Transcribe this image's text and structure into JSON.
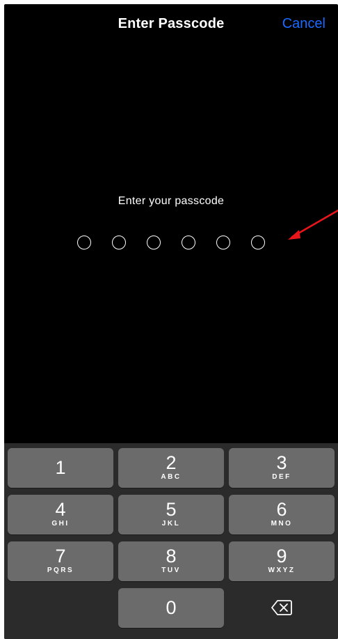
{
  "nav": {
    "title": "Enter Passcode",
    "cancel_label": "Cancel",
    "cancel_color": "#1a6aff"
  },
  "prompt": "Enter your passcode",
  "passcode": {
    "length": 6,
    "entered": 0
  },
  "annotation": {
    "type": "arrow",
    "color": "#e8161a",
    "points_to": "passcode-dots"
  },
  "keypad": {
    "keys": [
      {
        "digit": "1",
        "letters": ""
      },
      {
        "digit": "2",
        "letters": "ABC"
      },
      {
        "digit": "3",
        "letters": "DEF"
      },
      {
        "digit": "4",
        "letters": "GHI"
      },
      {
        "digit": "5",
        "letters": "JKL"
      },
      {
        "digit": "6",
        "letters": "MNO"
      },
      {
        "digit": "7",
        "letters": "PQRS"
      },
      {
        "digit": "8",
        "letters": "TUV"
      },
      {
        "digit": "9",
        "letters": "WXYZ"
      },
      {
        "digit": "0",
        "letters": ""
      }
    ],
    "delete_icon": "delete-backspace-icon"
  }
}
